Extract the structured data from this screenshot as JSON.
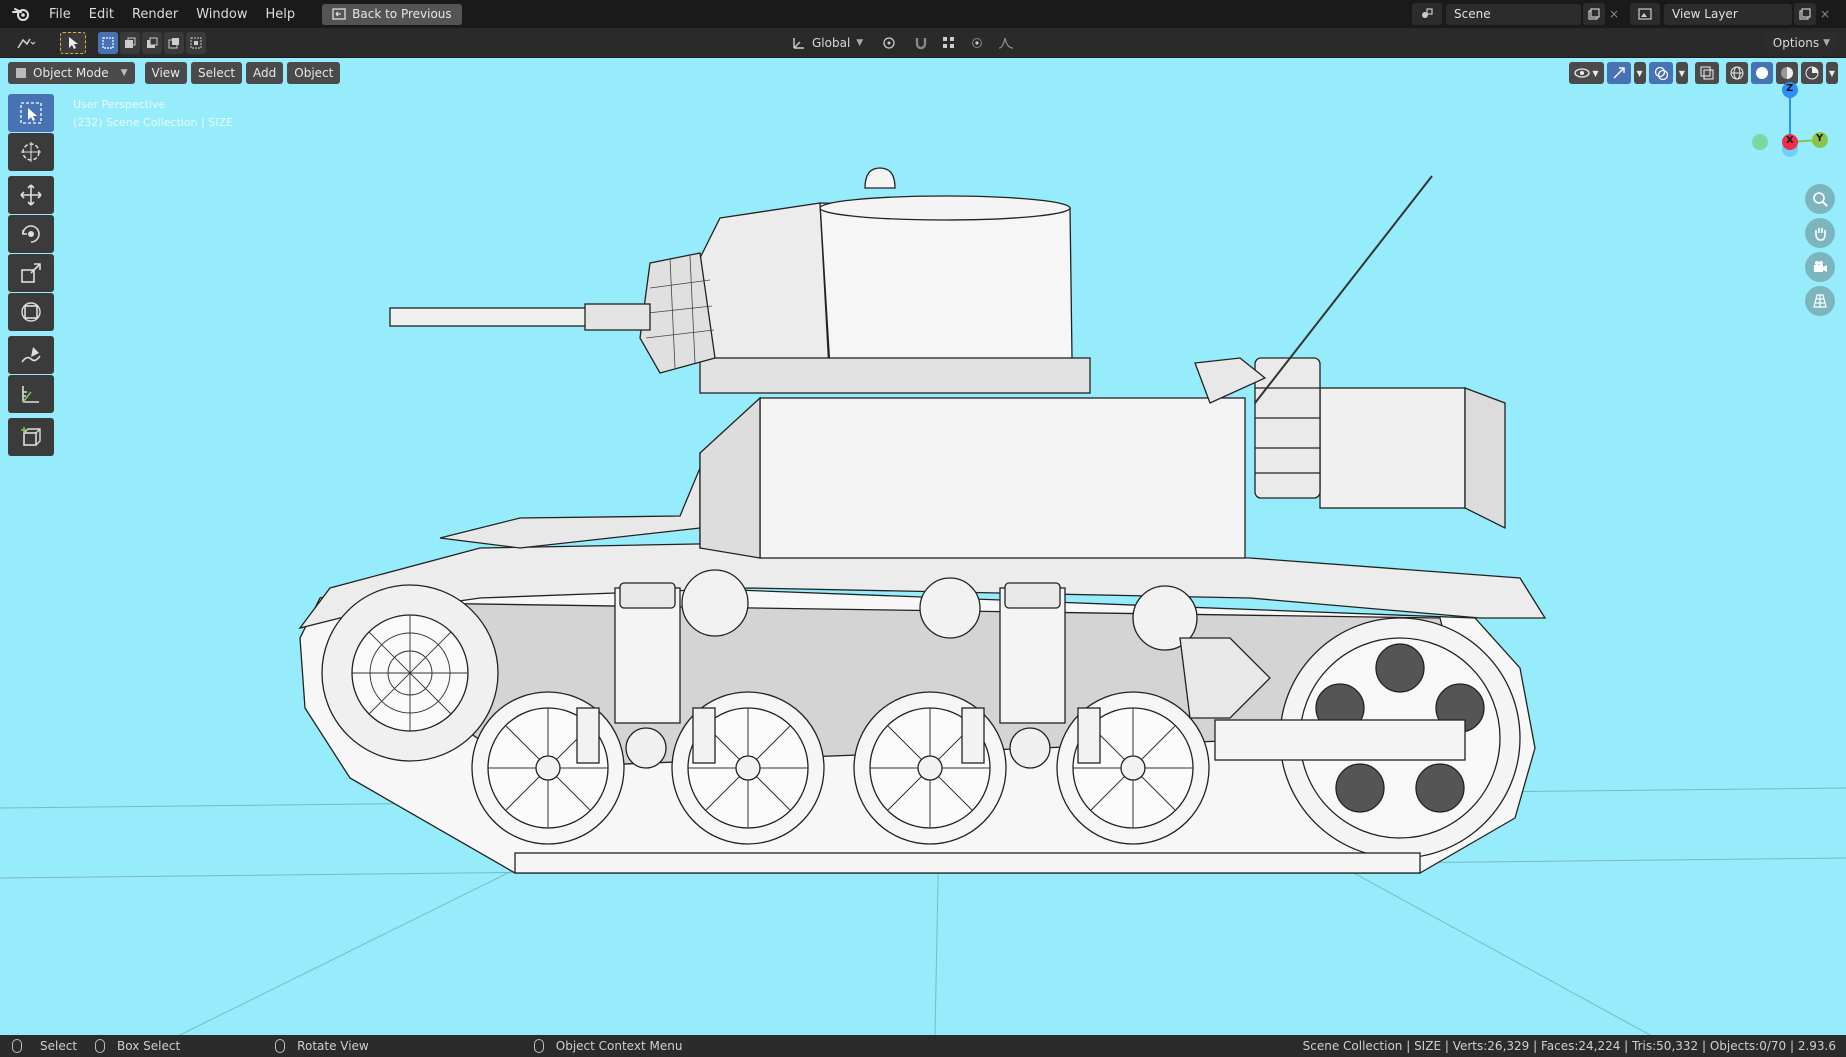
{
  "menubar": {
    "menus": [
      "File",
      "Edit",
      "Render",
      "Window",
      "Help"
    ],
    "back_label": "Back to Previous",
    "scene": "Scene",
    "view_layer": "View Layer"
  },
  "tool_header": {
    "orientation": "Global",
    "options": "Options"
  },
  "viewport_header": {
    "mode": "Object Mode",
    "menus": [
      "View",
      "Select",
      "Add",
      "Object"
    ]
  },
  "overlay": {
    "perspective": "User Perspective",
    "collection": "(232) Scene Collection | SIZE"
  },
  "gizmo": {
    "z": "Z",
    "x": "X",
    "y": "Y"
  },
  "statusbar": {
    "select": "Select",
    "box_select": "Box Select",
    "rotate_view": "Rotate View",
    "context_menu": "Object Context Menu",
    "stats": "Scene Collection | SIZE | Verts:26,329 | Faces:24,224 | Tris:50,332 | Objects:0/70 | 2.93.6"
  },
  "colors": {
    "viewport_bg": "#96ecfa",
    "active_tool": "#4772b3",
    "axis_x": "#e8304a",
    "axis_y": "#8bc34a",
    "axis_z": "#2f8ef5"
  }
}
